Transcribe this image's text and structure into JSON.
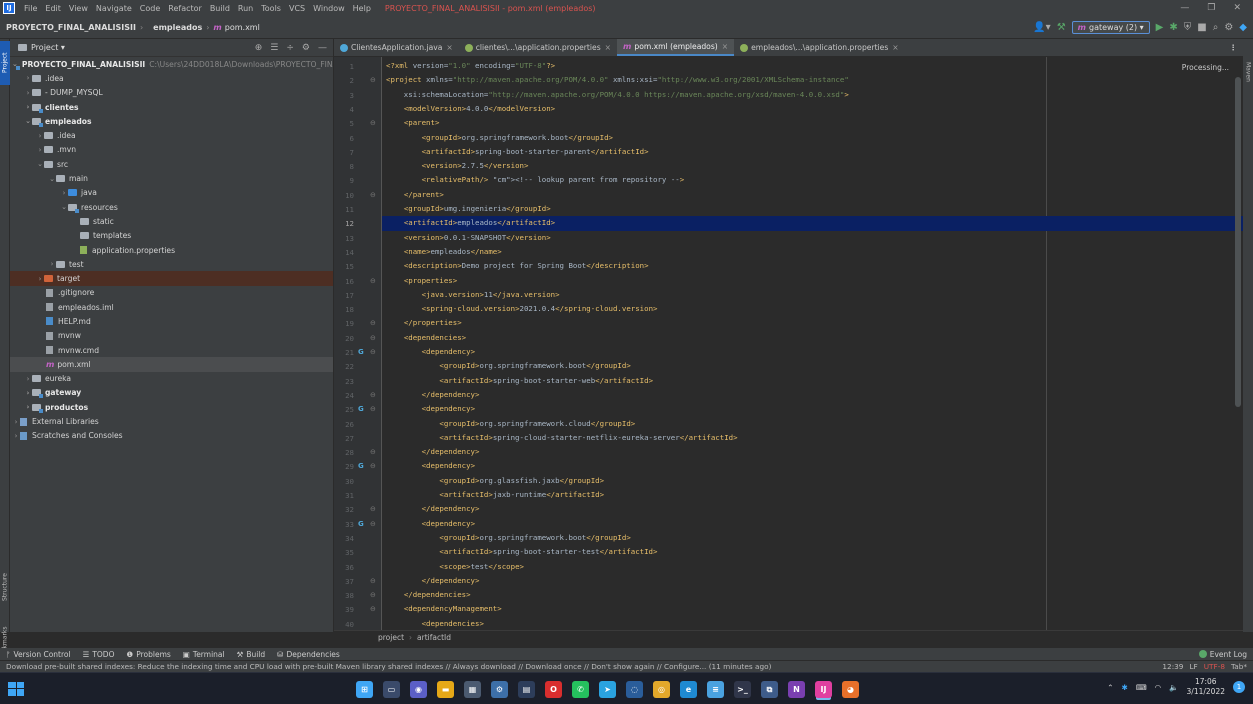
{
  "menubar": {
    "items": [
      "File",
      "Edit",
      "View",
      "Navigate",
      "Code",
      "Refactor",
      "Build",
      "Run",
      "Tools",
      "VCS",
      "Window",
      "Help"
    ],
    "window_title": "PROYECTO_FINAL_ANALISISII - pom.xml (empleados)"
  },
  "navbar": {
    "crumbs": [
      "PROYECTO_FINAL_ANALISISII",
      "empleados",
      "pom.xml"
    ],
    "run_config": "gateway (2)"
  },
  "strip": {
    "project": "Project",
    "structure": "Structure",
    "bookmarks": "Bookmarks",
    "maven": "Maven"
  },
  "project_panel": {
    "title": "Project",
    "root_name": "PROYECTO_FINAL_ANALISISII",
    "root_path": "C:\\Users\\24DD018LA\\Downloads\\PROYECTO_FINA",
    "tree": {
      "idea": ".idea",
      "dump": "- DUMP_MYSQL",
      "clientes": "clientes",
      "empleados": "empleados",
      "e_idea": ".idea",
      "e_mvn": ".mvn",
      "src": "src",
      "main": "main",
      "java": "java",
      "resources": "resources",
      "static": "static",
      "templates": "templates",
      "app_props": "application.properties",
      "test": "test",
      "target": "target",
      "gitignore": ".gitignore",
      "iml": "empleados.iml",
      "help": "HELP.md",
      "mvnw": "mvnw",
      "mvnwcmd": "mvnw.cmd",
      "pom": "pom.xml",
      "eureka": "eureka",
      "gateway": "gateway",
      "productos": "productos",
      "extlibs": "External Libraries",
      "scratches": "Scratches and Consoles"
    }
  },
  "tabs": [
    {
      "label": "ClientesApplication.java",
      "color": "#4fa8d9"
    },
    {
      "label": "clientes\\...\\application.properties",
      "color": "#8db05a"
    },
    {
      "label": "pom.xml (empleados)",
      "color": "#c364c6"
    },
    {
      "label": "empleados\\...\\application.properties",
      "color": "#8db05a"
    }
  ],
  "editor": {
    "processing": "Processing...",
    "breadcrumb": [
      "project",
      "artifactId"
    ],
    "lines": {
      "l1": "<?xml version=\"1.0\" encoding=\"UTF-8\"?>",
      "l2": "<project xmlns=\"http://maven.apache.org/POM/4.0.0\" xmlns:xsi=\"http://www.w3.org/2001/XMLSchema-instance\"",
      "l3": "    xsi:schemaLocation=\"http://maven.apache.org/POM/4.0.0 https://maven.apache.org/xsd/maven-4.0.0.xsd\">",
      "l4": "    <modelVersion>4.0.0</modelVersion>",
      "l5": "    <parent>",
      "l6": "        <groupId>org.springframework.boot</groupId>",
      "l7": "        <artifactId>spring-boot-starter-parent</artifactId>",
      "l8": "        <version>2.7.5</version>",
      "l9": "        <relativePath/> <!-- lookup parent from repository -->",
      "l10": "    </parent>",
      "l11": "    <groupId>umg.ingenieria</groupId>",
      "l12": "    <artifactId>empleados</artifactId>",
      "l13": "    <version>0.0.1-SNAPSHOT</version>",
      "l14": "    <name>empleados</name>",
      "l15": "    <description>Demo project for Spring Boot</description>",
      "l16": "    <properties>",
      "l17": "        <java.version>11</java.version>",
      "l18": "        <spring-cloud.version>2021.0.4</spring-cloud.version>",
      "l19": "    </properties>",
      "l20": "    <dependencies>",
      "l21": "        <dependency>",
      "l22": "            <groupId>org.springframework.boot</groupId>",
      "l23": "            <artifactId>spring-boot-starter-web</artifactId>",
      "l24": "        </dependency>",
      "l25": "        <dependency>",
      "l26": "            <groupId>org.springframework.cloud</groupId>",
      "l27": "            <artifactId>spring-cloud-starter-netflix-eureka-server</artifactId>",
      "l28": "        </dependency>",
      "l29": "        <dependency>",
      "l30": "            <groupId>org.glassfish.jaxb</groupId>",
      "l31": "            <artifactId>jaxb-runtime</artifactId>",
      "l32": "        </dependency>",
      "l33": "        <dependency>",
      "l34": "            <groupId>org.springframework.boot</groupId>",
      "l35": "            <artifactId>spring-boot-starter-test</artifactId>",
      "l36": "            <scope>test</scope>",
      "l37": "        </dependency>",
      "l38": "    </dependencies>",
      "l39": "    <dependencyManagement>",
      "l40": "        <dependencies>"
    },
    "current_line": 12
  },
  "toolwindows": [
    "Version Control",
    "TODO",
    "Problems",
    "Terminal",
    "Build",
    "Dependencies"
  ],
  "event_log": "Event Log",
  "status": {
    "message": "Download pre-built shared indexes: Reduce the indexing time and CPU load with pre-built Maven library shared indexes // Always download // Download once // Don't show again // Configure... (11 minutes ago)",
    "position": "12:39",
    "line_sep": "LF",
    "encoding": "UTF-8",
    "indent": "Tab*"
  },
  "taskbar": {
    "time": "17:06",
    "date": "3/11/2022",
    "notifications": "1"
  }
}
